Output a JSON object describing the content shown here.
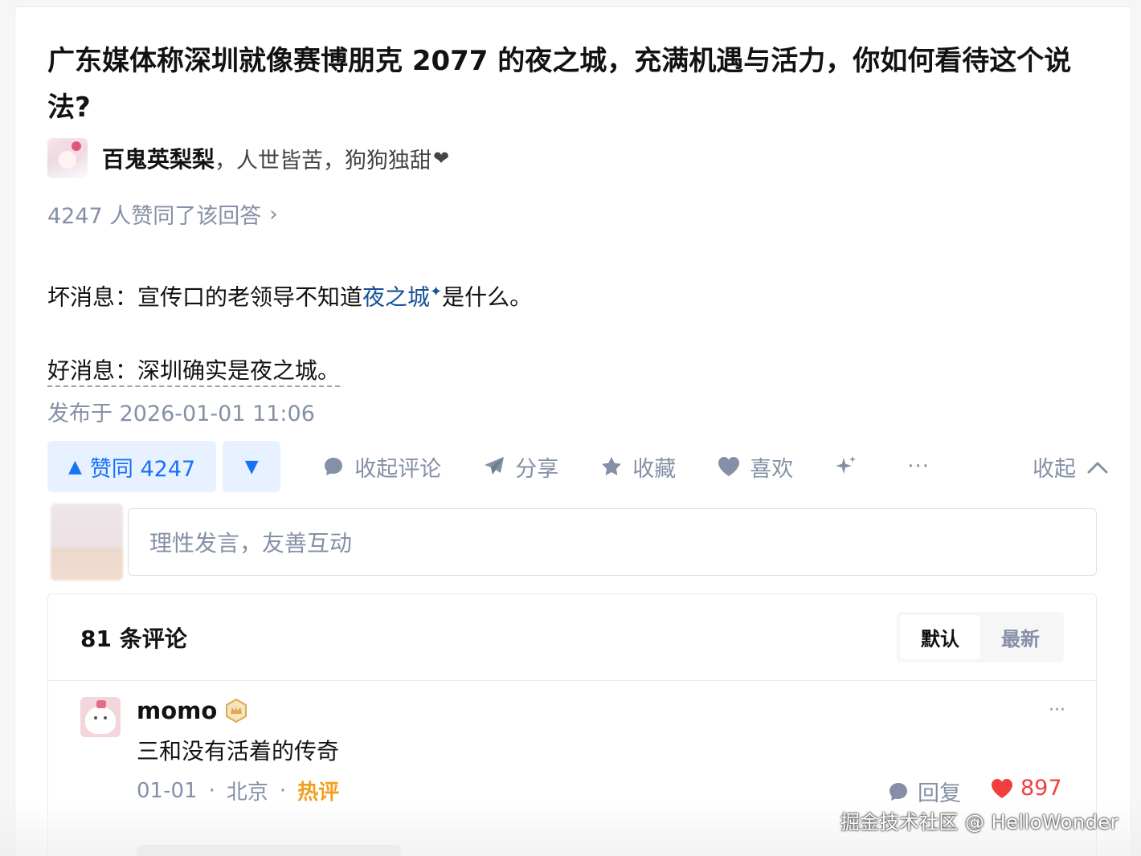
{
  "question": {
    "title": "广东媒体称深圳就像赛博朋克 2077 的夜之城，充满机遇与活力，你如何看待这个说法?"
  },
  "author": {
    "name": "百鬼英梨梨",
    "bio": "，人世皆苦，狗狗独甜",
    "heart": "❤"
  },
  "voters": {
    "text": "4247 人赞同了该回答",
    "chevron": "›"
  },
  "content": {
    "line1_prefix": "坏消息：宣传口的老领导不知道",
    "line1_link": "夜之城",
    "line1_link_mark": "✦",
    "line1_suffix": "是什么。",
    "line2": "好消息：深圳确实是夜之城。"
  },
  "publish": {
    "text": "发布于 2026-01-01 11:06"
  },
  "actions": {
    "vote_up_label": "赞同 4247",
    "vote_up_icon": "▲",
    "vote_down_icon": "▼",
    "comment_label": "收起评论",
    "share_label": "分享",
    "collect_label": "收藏",
    "like_label": "喜欢",
    "more_label": "···",
    "collapse_label": "收起",
    "icons": [
      "comment-bubble-icon",
      "share-plane-icon",
      "star-icon",
      "heart-icon",
      "sparkle-icon",
      "more-dots-icon",
      "chevron-up-icon"
    ]
  },
  "comment_input": {
    "placeholder": "理性发言，友善互动"
  },
  "comments": {
    "count_label": "81 条评论",
    "sort_default": "默认",
    "sort_latest": "最新",
    "items": [
      {
        "author": "momo",
        "text": "三和没有活着的传奇",
        "date": "01-01",
        "location": "北京",
        "tag": "热评",
        "reply_label": "回复",
        "likes": "897",
        "more": "···",
        "sep": "·"
      }
    ]
  },
  "watermark": {
    "text": "掘金技术社区 @ HelloWonder"
  },
  "colors": {
    "accent": "#1772f6",
    "accent_bg": "#e8f1ff",
    "muted": "#8590a6",
    "link": "#175199",
    "hot": "#f0a020",
    "like_red": "#f1403c"
  }
}
